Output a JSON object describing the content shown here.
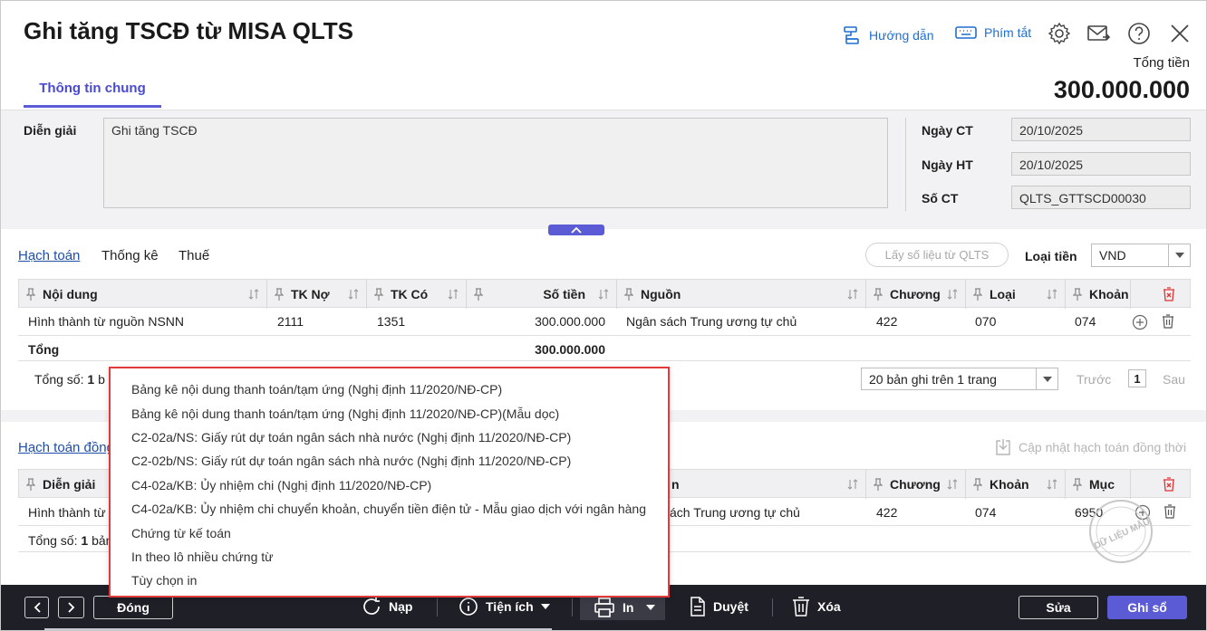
{
  "header": {
    "title": "Ghi tăng TSCĐ từ MISA QLTS",
    "guide_label": "Hướng dẫn",
    "shortcut_label": "Phím tắt",
    "total_label": "Tổng tiền",
    "total_value": "300.000.000"
  },
  "tabs": {
    "general": "Thông tin chung"
  },
  "info": {
    "description_label": "Diễn giải",
    "description_value": "Ghi tăng TSCĐ",
    "date_ct_label": "Ngày CT",
    "date_ct_value": "20/10/2025",
    "date_ht_label": "Ngày HT",
    "date_ht_value": "20/10/2025",
    "so_ct_label": "Số CT",
    "so_ct_value": "QLTS_GTTSCD00030"
  },
  "accounting": {
    "tabs": [
      "Hạch toán",
      "Thống kê",
      "Thuế"
    ],
    "fetch_button": "Lấy số liệu từ QLTS",
    "currency_label": "Loại tiền",
    "currency_value": "VND",
    "columns": [
      "Nội dung",
      "TK Nợ",
      "TK Có",
      "Số tiền",
      "Nguồn",
      "Chương",
      "Loại",
      "Khoản"
    ],
    "row": [
      "Hình thành từ nguồn NSNN",
      "2111",
      "1351",
      "300.000.000",
      "Ngân sách Trung ương tự chủ",
      "422",
      "070",
      "074"
    ],
    "total_label": "Tổng",
    "total_value": "300.000.000",
    "count_label": "Tổng số:",
    "count_value": "1",
    "count_suffix": "b",
    "page_size": "20 bản ghi trên 1 trang",
    "prev": "Trước",
    "page": "1",
    "next": "Sau"
  },
  "sync": {
    "tab": "Hạch toán đồng",
    "update_button": "Cập nhật hạch toán đồng thời",
    "columns": [
      "Diễn giải",
      "n",
      "Chương",
      "Khoản",
      "Mục"
    ],
    "row": [
      "Hình thành từ",
      "ách Trung ương tự chủ",
      "422",
      "074",
      "6950"
    ],
    "count_label": "Tổng số:",
    "count_value": "1",
    "count_suffix": "bản"
  },
  "print_menu": {
    "items": [
      "Bảng kê nội dung thanh toán/tạm ứng (Nghị định 11/2020/NĐ-CP)",
      "Bảng kê nội dung thanh toán/tạm ứng (Nghị định 11/2020/NĐ-CP)(Mẫu dọc)",
      "C2-02a/NS: Giấy rút dự toán ngân sách nhà nước (Nghị định 11/2020/NĐ-CP)",
      "C2-02b/NS: Giấy rút dự toán ngân sách nhà nước (Nghị định 11/2020/NĐ-CP)",
      "C4-02a/KB: Ủy nhiệm chi (Nghị định 11/2020/NĐ-CP)",
      "C4-02a/KB: Ủy nhiệm chi chuyển khoản, chuyển tiền điện tử - Mẫu giao dịch với ngân hàng",
      "Chứng từ kế toán",
      "In theo lô nhiều chứng từ",
      "Tùy chọn in"
    ]
  },
  "footer": {
    "close": "Đóng",
    "reload": "Nạp",
    "utilities": "Tiện ích",
    "print": "In",
    "approve": "Duyệt",
    "delete": "Xóa",
    "edit": "Sửa",
    "post": "Ghi sổ"
  },
  "watermark": "DỮ LIỆU MẪU",
  "colors": {
    "accent": "#5b5bd6",
    "link": "#1f6fd1",
    "footer_bg": "#1f1f28",
    "menu_border": "#e03a3a"
  }
}
